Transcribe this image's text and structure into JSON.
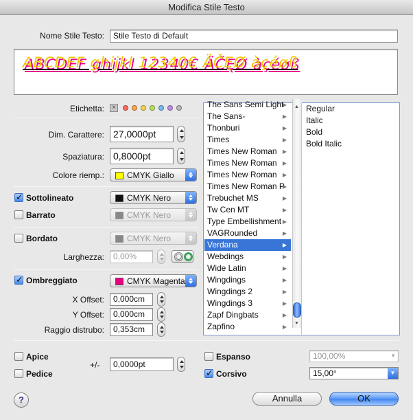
{
  "window": {
    "title": "Modifica Stile Testo"
  },
  "name_field": {
    "label": "Nome Stile Testo:",
    "value": "Stile Testo di Default"
  },
  "preview": {
    "text": "ABCDEF ghijkl 12340€ ÄČĘØ àçéøß"
  },
  "label_row": {
    "label": "Etichetta:",
    "colors": [
      "#ff6b5e",
      "#ffa44a",
      "#f5d64a",
      "#b8e05c",
      "#7ab8f5",
      "#c08ee6",
      "#b8b8b8"
    ]
  },
  "size": {
    "label": "Dim. Carattere:",
    "value": "27,0000pt"
  },
  "spacing": {
    "label": "Spaziatura:",
    "value": "0,8000pt"
  },
  "fill_color": {
    "label": "Colore riemp.:",
    "value": "CMYK Giallo",
    "swatch": "#ffff00"
  },
  "underline": {
    "label": "Sottolineato",
    "checked": true,
    "color": "CMYK Nero",
    "swatch": "#111111"
  },
  "strikethrough": {
    "label": "Barrato",
    "checked": false,
    "color": "CMYK Nero",
    "swatch": "#888888"
  },
  "outline": {
    "label": "Bordato",
    "checked": false,
    "color": "CMYK Nero",
    "swatch": "#888888"
  },
  "width": {
    "label": "Larghezza:",
    "value": "0,00%"
  },
  "shadow": {
    "label": "Ombreggiato",
    "checked": true,
    "color": "CMYK Magenta",
    "swatch": "#e6007e"
  },
  "x_offset": {
    "label": "X Offset:",
    "value": "0,000cm"
  },
  "y_offset": {
    "label": "Y Offset:",
    "value": "0,000cm"
  },
  "blur": {
    "label": "Raggio distrubo:",
    "value": "0,353cm"
  },
  "fonts": [
    "The Sans Semi Light",
    "The Sans-",
    "Thonburi",
    "Times",
    "Times New Roman",
    "Times New Roman",
    "Times New Roman",
    "Times New Roman P",
    "Trebuchet MS",
    "Tw Cen MT",
    "Type Embellishment",
    "VAGRounded",
    "Verdana",
    "Webdings",
    "Wide Latin",
    "Wingdings",
    "Wingdings 2",
    "Wingdings 3",
    "Zapf Dingbats",
    "Zapfino"
  ],
  "selected_font_index": 12,
  "styles": [
    "Regular",
    "Italic",
    "Bold",
    "Bold Italic"
  ],
  "superscript": {
    "label": "Apice",
    "checked": false
  },
  "subscript": {
    "label": "Pedice",
    "checked": false
  },
  "baseline": {
    "label": "+/-",
    "value": "0,0000pt"
  },
  "expanded": {
    "label": "Espanso",
    "checked": false,
    "value": "100,00%"
  },
  "italic": {
    "label": "Corsivo",
    "checked": true,
    "value": "15,00°"
  },
  "buttons": {
    "help": "?",
    "cancel": "Annulla",
    "ok": "OK"
  }
}
